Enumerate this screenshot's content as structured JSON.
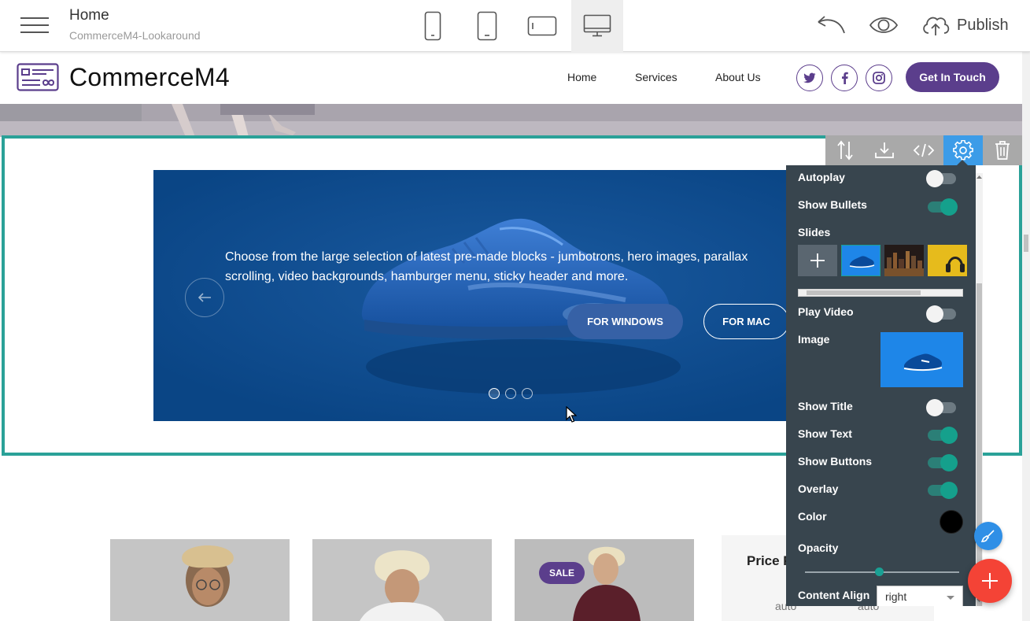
{
  "topbar": {
    "page_title": "Home",
    "page_subtitle": "CommerceM4-Lookaround",
    "publish_label": "Publish"
  },
  "site": {
    "brand": "CommerceM4",
    "nav": [
      "Home",
      "Services",
      "About Us"
    ],
    "cta_label": "Get In Touch",
    "accent_color": "#5b3e8c"
  },
  "slider": {
    "text": "Choose from the large selection of latest pre-made blocks - jumbotrons, hero images, parallax scrolling, video backgrounds, hamburger menu, sticky header and more.",
    "buttons": [
      "FOR WINDOWS",
      "FOR MAC"
    ],
    "bullet_count": 3,
    "active_bullet": 0
  },
  "panel": {
    "autoplay_label": "Autoplay",
    "show_bullets_label": "Show Bullets",
    "slides_label": "Slides",
    "play_video_label": "Play Video",
    "image_label": "Image",
    "show_title_label": "Show Title",
    "show_text_label": "Show Text",
    "show_buttons_label": "Show Buttons",
    "overlay_label": "Overlay",
    "color_label": "Color",
    "opacity_label": "Opacity",
    "opacity_value": 0.48,
    "content_align_label": "Content Align",
    "content_align_value": "right",
    "overlay_color": "#000000",
    "toggles": {
      "autoplay": false,
      "show_bullets": true,
      "play_video": false,
      "show_title": false,
      "show_text": true,
      "show_buttons": true,
      "overlay": true
    }
  },
  "products": {
    "sale_badge": "SALE",
    "price_title": "Price F",
    "auto_values": [
      "auto",
      "auto"
    ]
  }
}
